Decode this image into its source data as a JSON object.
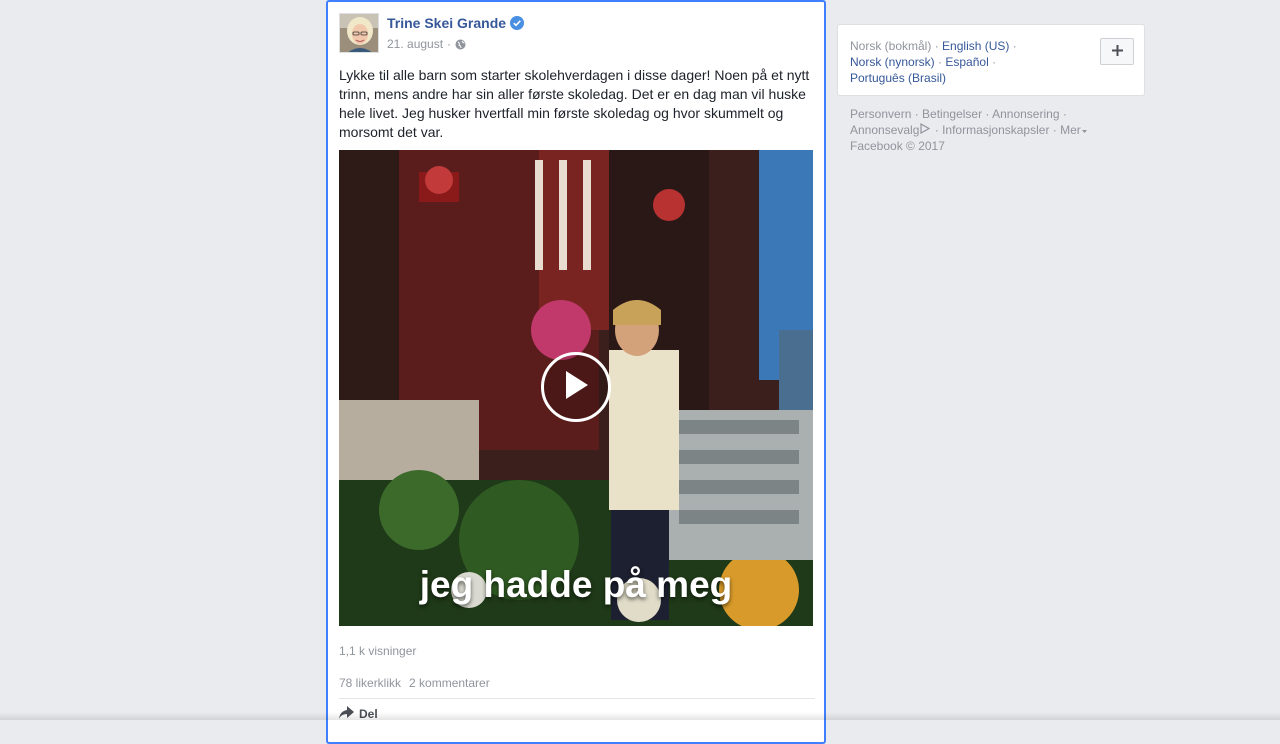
{
  "post": {
    "author": "Trine Skei Grande",
    "date": "21. august",
    "date_sep": "·",
    "text": "Lykke til alle barn som starter skolehverdagen i disse dager! Noen på et nytt trinn, mens andre har sin aller første skoledag. Det er en dag man vil huske hele livet. Jeg husker hvertfall min første skoledag og hvor skummelt og morsomt det var.",
    "video_caption": "jeg hadde på meg",
    "views": "1,1 k visninger",
    "likes": "78 likerklikk",
    "comments": "2 kommentarer",
    "share_label": "Del"
  },
  "languages": {
    "current": "Norsk (bokmål)",
    "options": [
      "English (US)",
      "Norsk (nynorsk)",
      "Español",
      "Português (Brasil)"
    ],
    "sep": "·"
  },
  "footer": {
    "links": [
      "Personvern",
      "Betingelser",
      "Annonsering",
      "Annonsevalg",
      "Informasjonskapsler",
      "Mer"
    ],
    "copyright": "Facebook © 2017"
  },
  "colors": {
    "link": "#365899",
    "accent_border": "#4080ff",
    "muted": "#90949c",
    "background": "#e9ebee"
  },
  "icons": [
    "verified-badge-icon",
    "globe-icon",
    "play-icon",
    "share-arrow-icon",
    "plus-icon",
    "adchoices-icon",
    "caret-down-icon"
  ]
}
